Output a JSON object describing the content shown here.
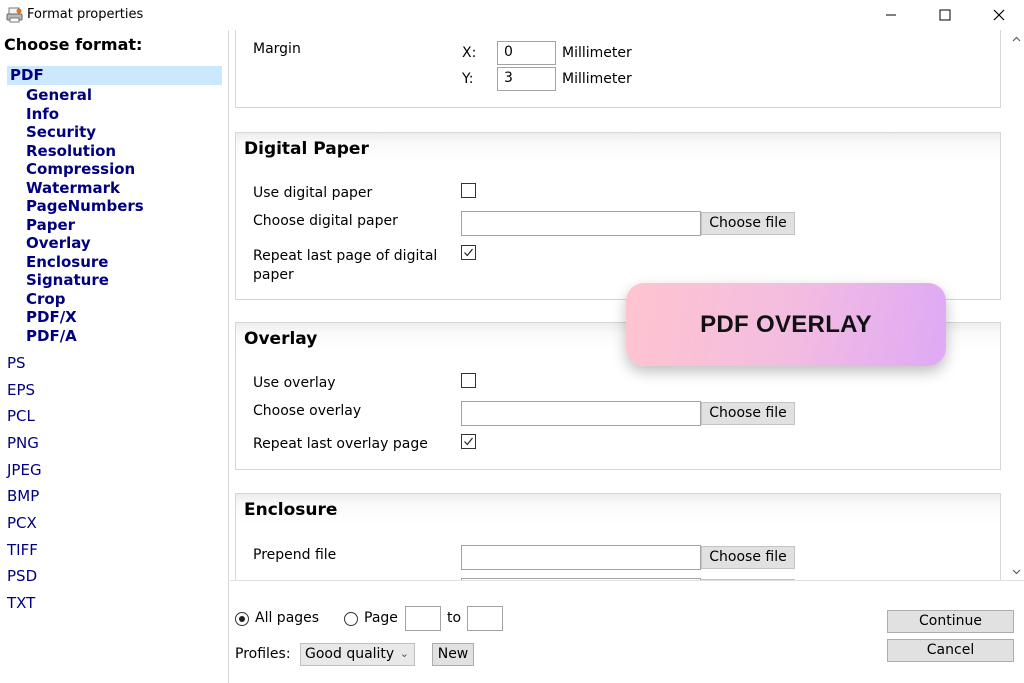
{
  "window": {
    "title": "Format properties"
  },
  "sidebar": {
    "heading": "Choose format:",
    "selected_format": "PDF",
    "pdf_subitems": [
      "General",
      "Info",
      "Security",
      "Resolution",
      "Compression",
      "Watermark",
      "PageNumbers",
      "Paper",
      "Overlay",
      "Enclosure",
      "Signature",
      "Crop",
      "PDF/X",
      "PDF/A"
    ],
    "formats": [
      "PS",
      "EPS",
      "PCL",
      "PNG",
      "JPEG",
      "BMP",
      "PCX",
      "TIFF",
      "PSD",
      "TXT"
    ]
  },
  "paper_section": {
    "margin_label": "Margin",
    "x_label": "X:",
    "x_value": "0",
    "x_unit": "Millimeter",
    "y_label": "Y:",
    "y_value": "3",
    "y_unit": "Millimeter"
  },
  "digital_paper": {
    "title": "Digital Paper",
    "use_label": "Use digital paper",
    "use_checked": false,
    "choose_label": "Choose digital paper",
    "choose_button": "Choose file",
    "repeat_label": "Repeat last page of digital paper",
    "repeat_checked": true
  },
  "overlay": {
    "title": "Overlay",
    "use_label": "Use overlay",
    "use_checked": false,
    "choose_label": "Choose overlay",
    "choose_button": "Choose file",
    "repeat_label": "Repeat last overlay page",
    "repeat_checked": true
  },
  "enclosure": {
    "title": "Enclosure",
    "prepend_label": "Prepend file",
    "choose_button": "Choose file"
  },
  "bottom": {
    "all_pages_label": "All pages",
    "all_pages_selected": true,
    "page_label": "Page",
    "to_label": "to",
    "profiles_label": "Profiles:",
    "profile_value": "Good quality",
    "new_button": "New",
    "continue_button": "Continue",
    "cancel_button": "Cancel"
  },
  "badge": {
    "text": "PDF OVERLAY"
  },
  "colors": {
    "tree_text": "#00007f",
    "selection": "#cce8ff"
  }
}
